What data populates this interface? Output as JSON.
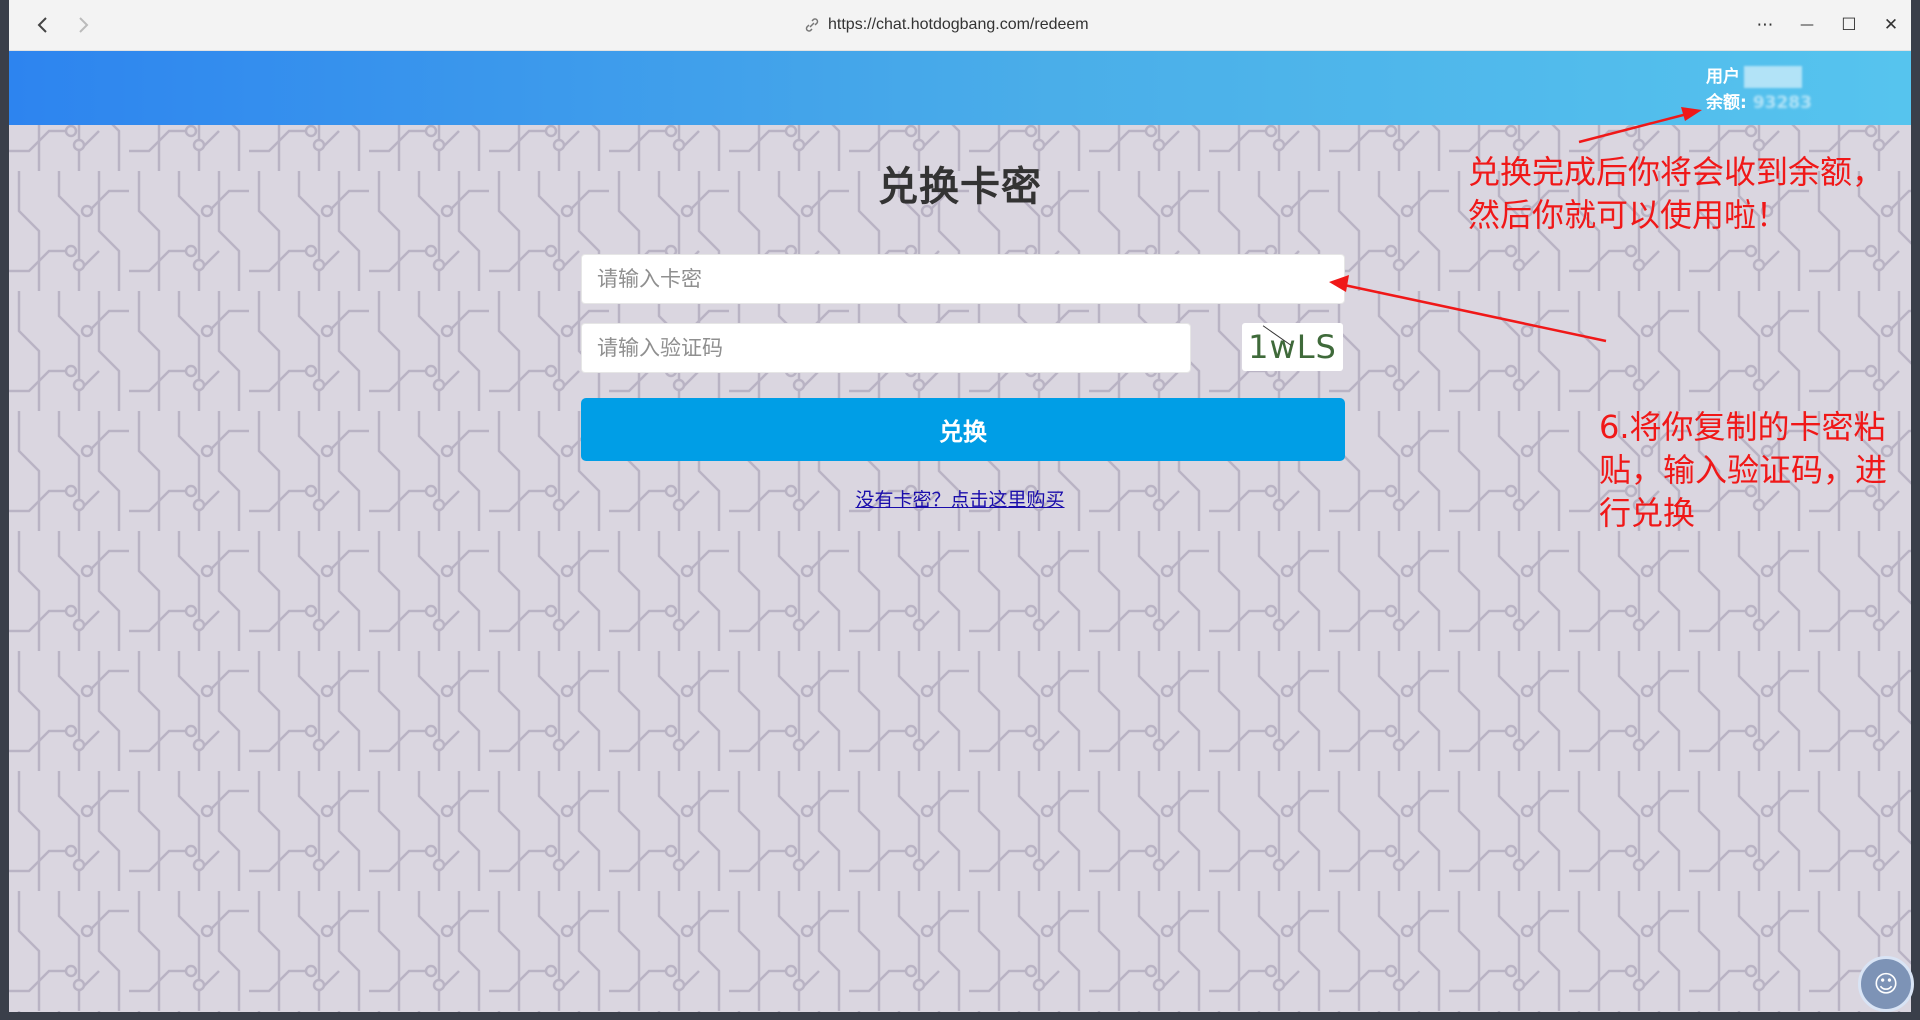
{
  "browser": {
    "url": "https://chat.hotdogbang.com/redeem",
    "back_icon": "chevron-left-icon",
    "forward_icon": "chevron-right-icon",
    "link_icon": "link-icon"
  },
  "window_controls": {
    "more": "⋯",
    "minimize": "—",
    "maximize": "☐",
    "close": "✕"
  },
  "header": {
    "user_label": "用户",
    "balance_label": "余额:",
    "balance_value": "93283"
  },
  "redeem": {
    "title": "兑换卡密",
    "card_placeholder": "请输入卡密",
    "captcha_placeholder": "请输入验证码",
    "captcha_text": "1wLS",
    "submit_label": "兑换",
    "buy_link": "没有卡密？点击这里购买"
  },
  "annotations": {
    "top": [
      "兑换完成后你将会收到余额，",
      "然后你就可以使用啦！"
    ],
    "bottom": [
      "6.将你复制的卡密粘",
      "贴，输入验证码，进",
      "行兑换"
    ]
  },
  "colors": {
    "header_start": "#2d84ef",
    "header_end": "#56c4ee",
    "submit": "#009ee6",
    "annotation": "#f01818",
    "background": "#dad6e0"
  }
}
